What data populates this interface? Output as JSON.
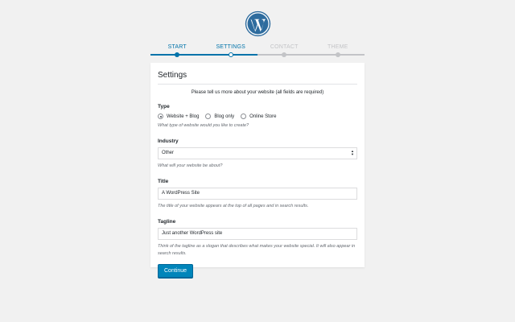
{
  "steps": [
    {
      "label": "START",
      "state": "done"
    },
    {
      "label": "SETTINGS",
      "state": "active"
    },
    {
      "label": "CONTACT",
      "state": "todo"
    },
    {
      "label": "THEME",
      "state": "todo"
    }
  ],
  "card": {
    "title": "Settings",
    "intro": "Please tell us more about your website (all fields are required)"
  },
  "type": {
    "label": "Type",
    "options": [
      "Website + Blog",
      "Blog only",
      "Online Store"
    ],
    "selected": "Website + Blog",
    "help": "What type of website would you like to create?"
  },
  "industry": {
    "label": "Industry",
    "value": "Other",
    "help": "What will your website be about?"
  },
  "title": {
    "label": "Title",
    "value": "A WordPress Site",
    "help": "The title of your website appears at the top of all pages and in search results."
  },
  "tagline": {
    "label": "Tagline",
    "value": "Just another WordPress site",
    "help": "Think of the tagline as a slogan that describes what makes your website special. It will also appear in search results."
  },
  "actions": {
    "continue_label": "Continue"
  },
  "colors": {
    "accent": "#0073aa",
    "button": "#0085ba",
    "inactive": "#c3c4c7"
  }
}
